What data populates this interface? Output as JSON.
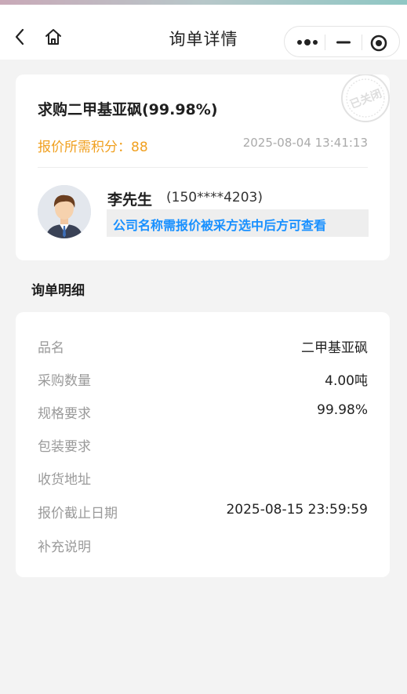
{
  "navbar": {
    "title": "询单详情",
    "back_icon": "chevron-left-icon",
    "home_icon": "home-icon",
    "capsule": {
      "more_icon": "more-dots-icon",
      "minimize_icon": "minimize-icon",
      "close_icon": "target-close-icon"
    }
  },
  "inquiry": {
    "title": "求购二甲基亚砜(99.98%)",
    "points_label": "报价所需积分：",
    "points_value": "88",
    "timestamp": "2025-08-04 13:41:13",
    "status_stamp": "已关闭",
    "contact": {
      "avatar_icon": "avatar-male-icon",
      "name": "李先生",
      "phone": "(150****4203)",
      "company_hint": "公司名称需报价被采方选中后方可查看"
    }
  },
  "details": {
    "section_title": "询单明细",
    "rows": [
      {
        "label": "品名",
        "value": "二甲基亚砜"
      },
      {
        "label": "采购数量",
        "value": "4.00吨"
      },
      {
        "label": "规格要求",
        "value": "99.98%"
      },
      {
        "label": "包装要求",
        "value": ""
      },
      {
        "label": "收货地址",
        "value": ""
      },
      {
        "label": "报价截止日期",
        "value": "2025-08-15 23:59:59"
      },
      {
        "label": "补充说明",
        "value": ""
      }
    ]
  },
  "colors": {
    "accent_orange": "#f0a020",
    "link_blue": "#1890ff",
    "background": "#f3f3f3"
  }
}
